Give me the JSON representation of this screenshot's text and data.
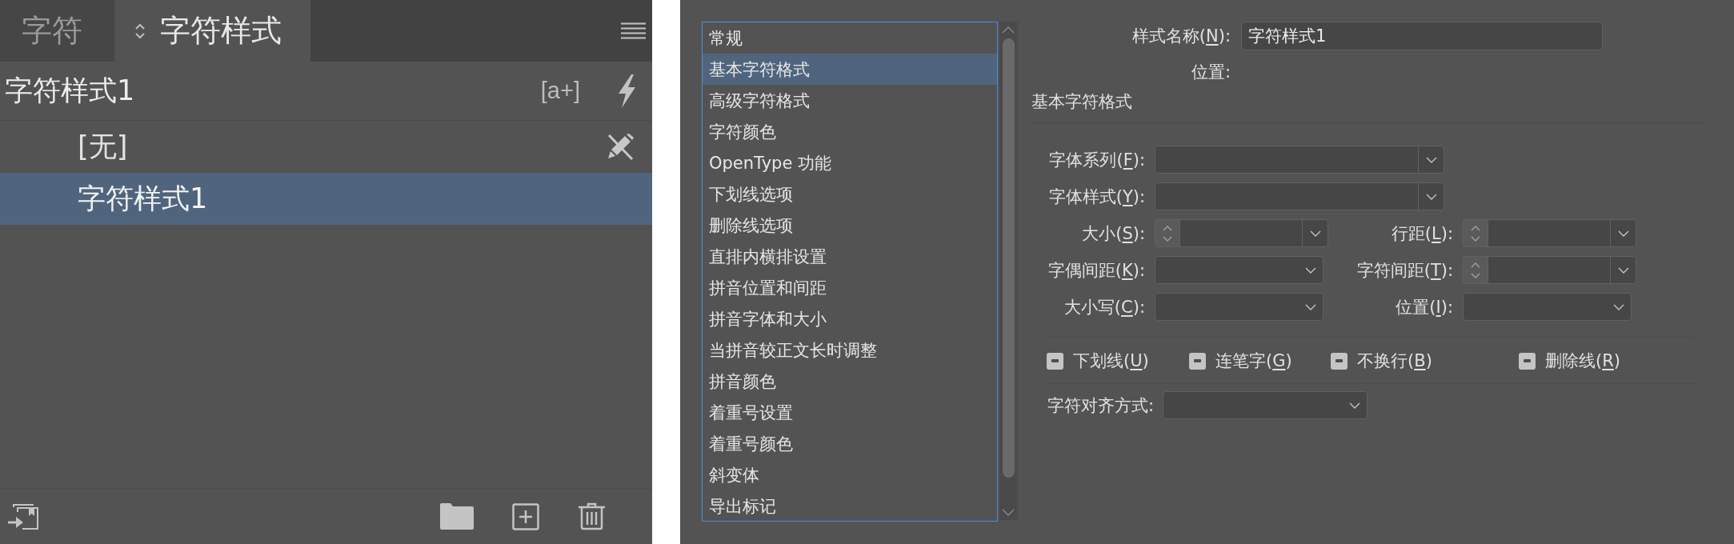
{
  "character_styles_panel": {
    "tabs": [
      {
        "label": "字符",
        "selected": false
      },
      {
        "label": "字符样式",
        "selected": true
      }
    ],
    "current_style": "字符样式1",
    "override_button": "[a+]",
    "styles": [
      {
        "name": "[无]",
        "selected": false,
        "editable": false
      },
      {
        "name": "字符样式1",
        "selected": true,
        "editable": true
      }
    ]
  },
  "style_options_dialog": {
    "categories": [
      {
        "label": "常规",
        "selected": false
      },
      {
        "label": "基本字符格式",
        "selected": true
      },
      {
        "label": "高级字符格式",
        "selected": false
      },
      {
        "label": "字符颜色",
        "selected": false
      },
      {
        "label": "OpenType 功能",
        "selected": false
      },
      {
        "label": "下划线选项",
        "selected": false
      },
      {
        "label": "删除线选项",
        "selected": false
      },
      {
        "label": "直排内横排设置",
        "selected": false
      },
      {
        "label": "拼音位置和间距",
        "selected": false
      },
      {
        "label": "拼音字体和大小",
        "selected": false
      },
      {
        "label": "当拼音较正文长时调整",
        "selected": false
      },
      {
        "label": "拼音颜色",
        "selected": false
      },
      {
        "label": "着重号设置",
        "selected": false
      },
      {
        "label": "着重号颜色",
        "selected": false
      },
      {
        "label": "斜变体",
        "selected": false
      },
      {
        "label": "导出标记",
        "selected": false
      }
    ],
    "style_name": {
      "label": "样式名称(N):",
      "value": "字符样式1"
    },
    "location": {
      "label": "位置:"
    },
    "section_title": "基本字符格式",
    "fields": [
      {
        "label": "字体系列(F):",
        "kind": "combo"
      },
      {
        "label": "字体样式(Y):",
        "kind": "combo"
      },
      {
        "label": "大小(S):",
        "kind": "spin-combo"
      },
      {
        "label": "行距(L):",
        "kind": "spin-combo"
      },
      {
        "label": "字偶间距(K):",
        "kind": "dropdown"
      },
      {
        "label": "字符间距(T):",
        "kind": "spin-combo"
      },
      {
        "label": "大小写(C):",
        "kind": "dropdown"
      },
      {
        "label": "位置(I):",
        "kind": "dropdown"
      }
    ],
    "options": [
      {
        "label": "下划线(U)",
        "indeterminate": true
      },
      {
        "label": "连笔字(G)",
        "indeterminate": true
      },
      {
        "label": "不换行(B)",
        "indeterminate": true
      },
      {
        "label": "删除线(R)",
        "indeterminate": true
      }
    ],
    "alignment": {
      "label": "字符对齐方式:",
      "kind": "dropdown"
    }
  }
}
